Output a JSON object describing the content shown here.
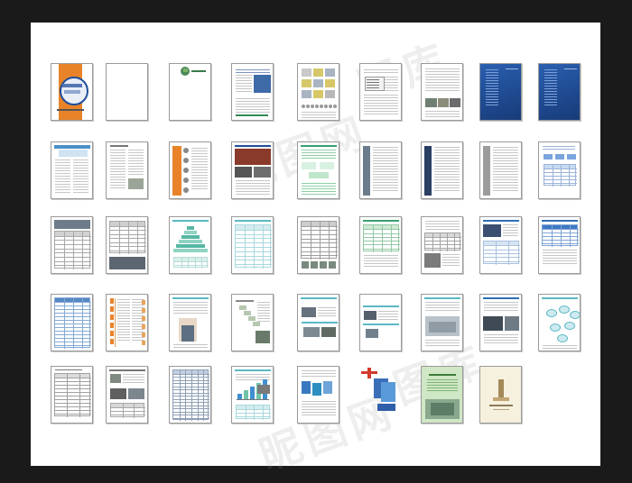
{
  "watermark": {
    "text": "昵图网",
    "brand": "图库"
  },
  "colors": {
    "frame": "#1a1a1a",
    "sheet": "#ffffff",
    "navy": "#1f4f9a",
    "orange": "#e8832a",
    "teal": "#5bb8c4"
  },
  "pages": [
    {
      "row": 0,
      "col": 0,
      "type": "cover-orange"
    },
    {
      "row": 0,
      "col": 1,
      "type": "blank"
    },
    {
      "row": 0,
      "col": 2,
      "type": "globe-title"
    },
    {
      "row": 0,
      "col": 3,
      "type": "text-photo-blue"
    },
    {
      "row": 0,
      "col": 4,
      "type": "image-grid"
    },
    {
      "row": 0,
      "col": 5,
      "type": "text-chart"
    },
    {
      "row": 0,
      "col": 6,
      "type": "text-photos"
    },
    {
      "row": 0,
      "col": 7,
      "type": "navy"
    },
    {
      "row": 0,
      "col": 8,
      "type": "navy"
    },
    {
      "row": 1,
      "col": 0,
      "type": "text-blue-header"
    },
    {
      "row": 1,
      "col": 1,
      "type": "text-columns"
    },
    {
      "row": 1,
      "col": 2,
      "type": "orange-sidebar"
    },
    {
      "row": 1,
      "col": 3,
      "type": "photo-collage"
    },
    {
      "row": 1,
      "col": 4,
      "type": "green-diagram"
    },
    {
      "row": 1,
      "col": 5,
      "type": "text-left-strip"
    },
    {
      "row": 1,
      "col": 6,
      "type": "text-left-strip-navy"
    },
    {
      "row": 1,
      "col": 7,
      "type": "text-left-strip-grey"
    },
    {
      "row": 1,
      "col": 8,
      "type": "blue-flow"
    },
    {
      "row": 2,
      "col": 0,
      "type": "grey-table"
    },
    {
      "row": 2,
      "col": 1,
      "type": "table-photo"
    },
    {
      "row": 2,
      "col": 2,
      "type": "pyramid"
    },
    {
      "row": 2,
      "col": 3,
      "type": "teal-table"
    },
    {
      "row": 2,
      "col": 4,
      "type": "grey-table-2"
    },
    {
      "row": 2,
      "col": 5,
      "type": "green-table"
    },
    {
      "row": 2,
      "col": 6,
      "type": "text-table"
    },
    {
      "row": 2,
      "col": 7,
      "type": "photo-text"
    },
    {
      "row": 2,
      "col": 8,
      "type": "blue-table"
    },
    {
      "row": 3,
      "col": 0,
      "type": "blue-table-dense"
    },
    {
      "row": 3,
      "col": 1,
      "type": "orange-zigzag"
    },
    {
      "row": 3,
      "col": 2,
      "type": "person-photo"
    },
    {
      "row": 3,
      "col": 3,
      "type": "diagram-photo"
    },
    {
      "row": 3,
      "col": 4,
      "type": "step-photos"
    },
    {
      "row": 3,
      "col": 5,
      "type": "step-photos-2"
    },
    {
      "row": 3,
      "col": 6,
      "type": "building-photo"
    },
    {
      "row": 3,
      "col": 7,
      "type": "photo-office"
    },
    {
      "row": 3,
      "col": 8,
      "type": "bubble-diagram"
    },
    {
      "row": 4,
      "col": 0,
      "type": "form-table"
    },
    {
      "row": 4,
      "col": 1,
      "type": "photos-table"
    },
    {
      "row": 4,
      "col": 2,
      "type": "dense-grid"
    },
    {
      "row": 4,
      "col": 3,
      "type": "bar-chart-page"
    },
    {
      "row": 4,
      "col": 4,
      "type": "books-page"
    },
    {
      "row": 4,
      "col": 5,
      "type": "red-plane"
    },
    {
      "row": 4,
      "col": 6,
      "type": "green-cover"
    },
    {
      "row": 4,
      "col": 7,
      "type": "cream-cover"
    }
  ]
}
